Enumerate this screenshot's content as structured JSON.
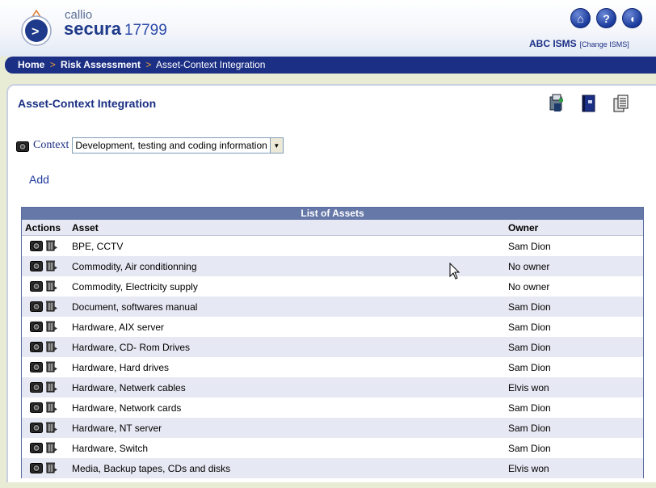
{
  "brand": {
    "small": "callio",
    "name": "secura",
    "version": "17799"
  },
  "top_icons": [
    {
      "name": "home-icon",
      "glyph": "⌂"
    },
    {
      "name": "help-icon",
      "glyph": "?"
    },
    {
      "name": "logout-icon",
      "glyph": "◖"
    }
  ],
  "org": {
    "name": "ABC ISMS",
    "change_label": "[Change ISMS]"
  },
  "breadcrumb": {
    "home": "Home",
    "sep": ">",
    "section": "Risk Assessment",
    "current": "Asset-Context Integration"
  },
  "panel": {
    "title": "Asset-Context Integration",
    "tools": [
      "print-icon",
      "book-icon",
      "report-icon"
    ]
  },
  "context": {
    "label": "Context",
    "selected": "Development, testing and coding information"
  },
  "add_label": "Add",
  "table": {
    "caption": "List of Assets",
    "headers": {
      "actions": "Actions",
      "asset": "Asset",
      "owner": "Owner"
    },
    "rows": [
      {
        "asset": "BPE, CCTV",
        "owner": "Sam Dion"
      },
      {
        "asset": "Commodity, Air conditionning",
        "owner": "No owner"
      },
      {
        "asset": "Commodity, Electricity supply",
        "owner": "No owner"
      },
      {
        "asset": "Document, softwares manual",
        "owner": "Sam Dion"
      },
      {
        "asset": "Hardware, AIX server",
        "owner": "Sam Dion"
      },
      {
        "asset": "Hardware, CD- Rom Drives",
        "owner": "Sam Dion"
      },
      {
        "asset": "Hardware, Hard drives",
        "owner": "Sam Dion"
      },
      {
        "asset": "Hardware, Netwerk cables",
        "owner": "Elvis won"
      },
      {
        "asset": "Hardware, Network cards",
        "owner": "Sam Dion"
      },
      {
        "asset": "Hardware, NT server",
        "owner": "Sam Dion"
      },
      {
        "asset": "Hardware, Switch",
        "owner": "Sam Dion"
      },
      {
        "asset": "Media, Backup tapes, CDs and disks",
        "owner": "Elvis won"
      }
    ]
  },
  "colors": {
    "navy": "#1b2f84",
    "caption_bg": "#6678a8",
    "alt_row": "#e6e9f3",
    "accent_orange": "#f0a23c"
  }
}
